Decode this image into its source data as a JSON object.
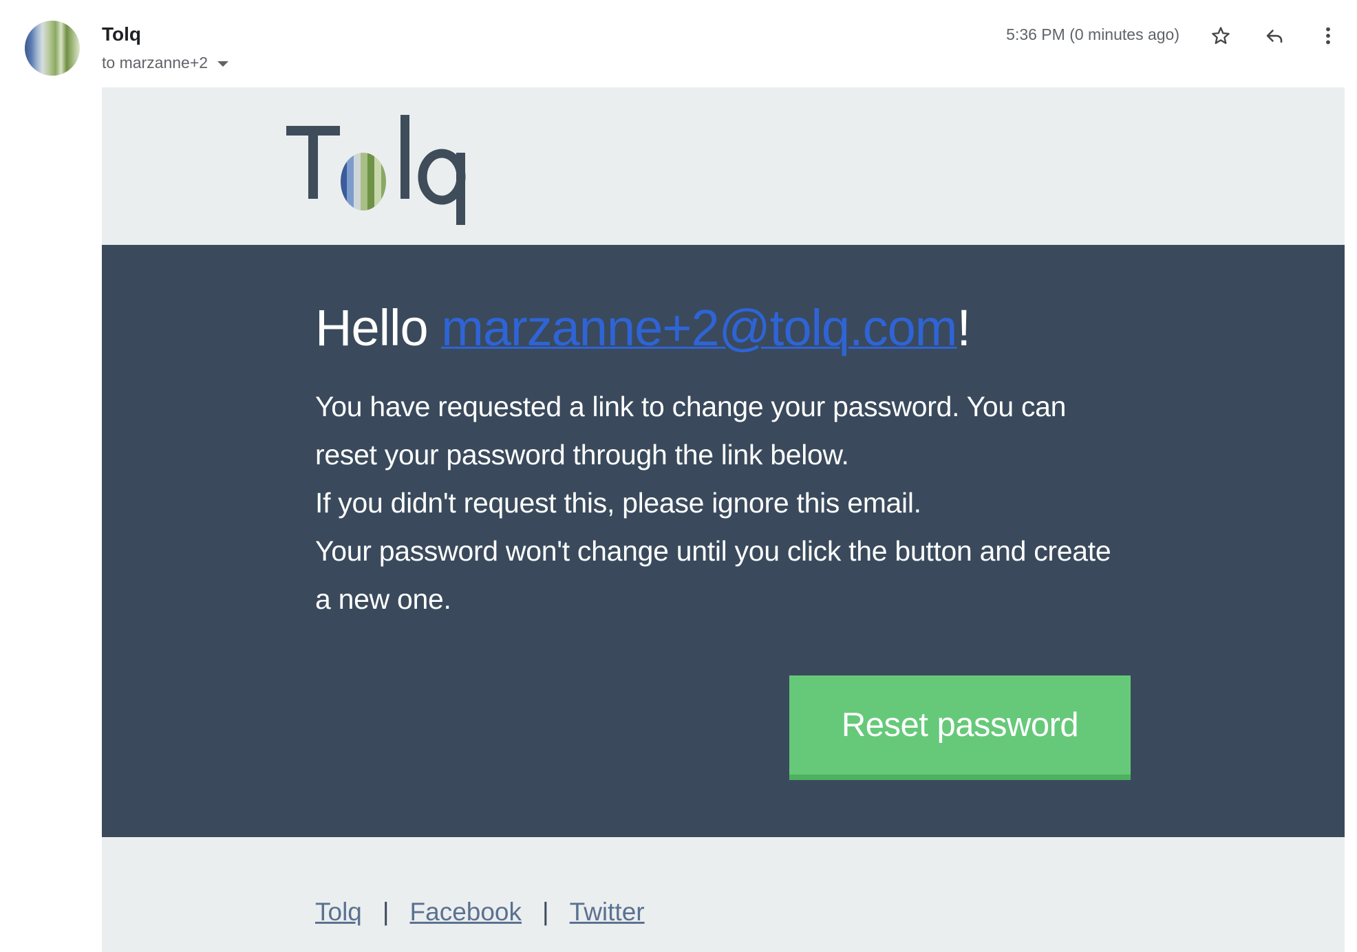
{
  "header": {
    "sender_name": "Tolq",
    "recipient": "to marzanne+2",
    "timestamp": "5:36 PM (0 minutes ago)",
    "icons": [
      "avatar",
      "chevron-down-icon",
      "star-icon",
      "reply-icon",
      "more-vert-icon"
    ]
  },
  "email": {
    "logo_text": "Tolq",
    "greeting_prefix": "Hello ",
    "greeting_email": "marzanne+2@tolq.com",
    "greeting_suffix": "!",
    "paragraph_1": "You have requested a link to change your password. You can reset your password through the link below.",
    "paragraph_2": "If you didn't request this, please ignore this email.",
    "paragraph_3": "Your password won't change until you click the button and create a new one.",
    "button_label": "Reset password",
    "footer_links": [
      "Tolq",
      "Facebook",
      "Twitter"
    ],
    "footer_separator": "|"
  },
  "colors": {
    "content_background": "#3a4a5c",
    "band_background": "#ebeeef",
    "button": "#66c97a",
    "link": "#2f64d6",
    "footer_link": "#5a7190"
  }
}
